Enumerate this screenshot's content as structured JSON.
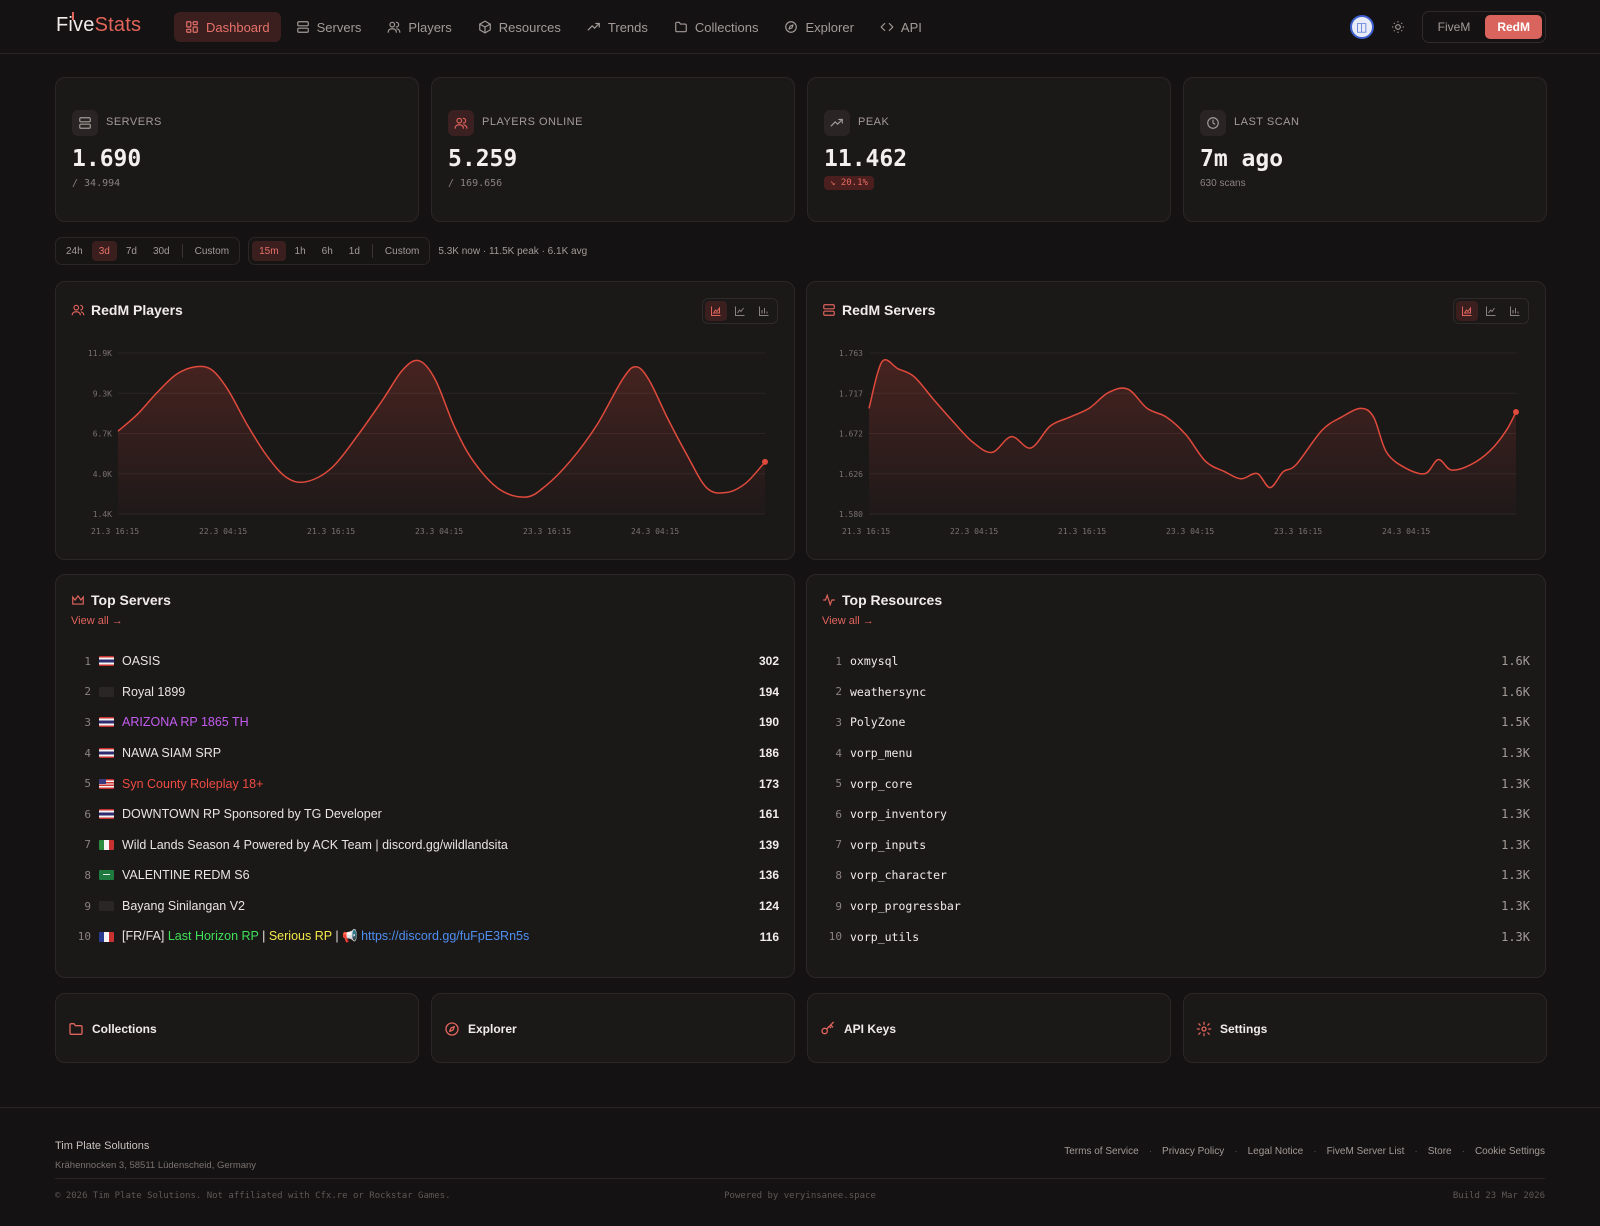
{
  "brand": {
    "first": "Five",
    "second": "Stats"
  },
  "nav": {
    "items": [
      {
        "label": "Dashboard",
        "icon": "dashboard-icon",
        "active": true
      },
      {
        "label": "Servers",
        "icon": "servers-icon"
      },
      {
        "label": "Players",
        "icon": "players-icon"
      },
      {
        "label": "Resources",
        "icon": "resources-icon"
      },
      {
        "label": "Trends",
        "icon": "trends-icon"
      },
      {
        "label": "Collections",
        "icon": "folder-icon"
      },
      {
        "label": "Explorer",
        "icon": "compass-icon"
      },
      {
        "label": "API",
        "icon": "code-icon"
      }
    ],
    "game_options": [
      "FiveM",
      "RedM"
    ],
    "game_selected": "RedM"
  },
  "stats": [
    {
      "label": "SERVERS",
      "value": "1.690",
      "sub": "/ 34.994",
      "icon": "servers-icon"
    },
    {
      "label": "PLAYERS ONLINE",
      "value": "5.259",
      "sub": "/ 169.656",
      "icon": "players-icon"
    },
    {
      "label": "PEAK",
      "value": "11.462",
      "badge": "↘ 20.1%",
      "icon": "trend-up-icon"
    },
    {
      "label": "LAST SCAN",
      "value": "7m ago",
      "sub": "630 scans",
      "icon": "clock-icon"
    }
  ],
  "filters": {
    "ranges": [
      "24h",
      "3d",
      "7d",
      "30d",
      "Custom"
    ],
    "range_selected": "3d",
    "intervals": [
      "15m",
      "1h",
      "6h",
      "1d",
      "Custom"
    ],
    "interval_selected": "15m",
    "summary": "5.3K now · 11.5K peak · 6.1K avg"
  },
  "charts": {
    "players": {
      "title": "RedM Players"
    },
    "servers": {
      "title": "RedM Servers"
    }
  },
  "chart_data": [
    {
      "type": "area",
      "title": "RedM Players",
      "ylim": [
        1400,
        11900
      ],
      "yticks": [
        "11.9K",
        "9.3K",
        "6.7K",
        "4.0K",
        "1.4K"
      ],
      "xticks": [
        "21.3 16:15",
        "22.3 04:15",
        "21.3 16:15",
        "23.3 04:15",
        "23.3 16:15",
        "24.3 04:15"
      ],
      "x_fraction": [
        0,
        0.03,
        0.06,
        0.09,
        0.12,
        0.145,
        0.17,
        0.2,
        0.23,
        0.26,
        0.29,
        0.33,
        0.37,
        0.41,
        0.44,
        0.465,
        0.49,
        0.52,
        0.55,
        0.59,
        0.63,
        0.66,
        0.7,
        0.74,
        0.78,
        0.8,
        0.82,
        0.85,
        0.88,
        0.91,
        0.94,
        0.97,
        1.0
      ],
      "values": [
        6800,
        7900,
        9300,
        10500,
        11000,
        10800,
        9500,
        7200,
        5200,
        3800,
        3500,
        4400,
        6500,
        8900,
        10800,
        11400,
        10200,
        7100,
        4800,
        3000,
        2500,
        3200,
        4900,
        7200,
        10200,
        11000,
        10200,
        7600,
        5200,
        3100,
        2800,
        3400,
        4800
      ]
    },
    {
      "type": "area",
      "title": "RedM Servers",
      "ylim": [
        1580,
        1763
      ],
      "yticks": [
        "1.763",
        "1.717",
        "1.672",
        "1.626",
        "1.580"
      ],
      "xticks": [
        "21.3 16:15",
        "22.3 04:15",
        "21.3 16:15",
        "23.3 04:15",
        "23.3 16:15",
        "24.3 04:15"
      ],
      "x_fraction": [
        0,
        0.02,
        0.045,
        0.07,
        0.1,
        0.13,
        0.16,
        0.19,
        0.22,
        0.25,
        0.28,
        0.31,
        0.34,
        0.37,
        0.4,
        0.43,
        0.46,
        0.49,
        0.52,
        0.55,
        0.575,
        0.6,
        0.62,
        0.64,
        0.66,
        0.7,
        0.73,
        0.76,
        0.78,
        0.8,
        0.83,
        0.86,
        0.88,
        0.9,
        0.93,
        0.96,
        0.985,
        1.0
      ],
      "values": [
        1700,
        1753,
        1745,
        1736,
        1710,
        1685,
        1662,
        1650,
        1668,
        1655,
        1680,
        1690,
        1700,
        1718,
        1722,
        1700,
        1690,
        1670,
        1640,
        1628,
        1620,
        1626,
        1610,
        1628,
        1636,
        1675,
        1690,
        1700,
        1690,
        1650,
        1632,
        1626,
        1642,
        1630,
        1636,
        1652,
        1675,
        1696
      ]
    }
  ],
  "top_servers": {
    "title": "Top Servers",
    "view_all": "View all →",
    "rows": [
      {
        "rank": "1",
        "flag": "th",
        "name": "OASIS",
        "count": "302"
      },
      {
        "rank": "2",
        "flag": "none",
        "name": "Royal 1899",
        "count": "194"
      },
      {
        "rank": "3",
        "flag": "th",
        "name": "ARIZONA RP 1865 TH",
        "count": "190",
        "color": "#c45cf0"
      },
      {
        "rank": "4",
        "flag": "th",
        "name": "NAWA SIAM SRP",
        "count": "186"
      },
      {
        "rank": "5",
        "flag": "us",
        "name": "Syn County Roleplay 18+",
        "count": "173",
        "color": "#ef4b43"
      },
      {
        "rank": "6",
        "flag": "th",
        "name": "DOWNTOWN RP Sponsored by TG Developer",
        "count": "161"
      },
      {
        "rank": "7",
        "flag": "it",
        "name": "Wild Lands Season 4 Powered by ACK Team | discord.gg/wildlandsita",
        "count": "139"
      },
      {
        "rank": "8",
        "flag": "sa",
        "name": "VALENTINE REDM S6",
        "count": "136"
      },
      {
        "rank": "9",
        "flag": "none",
        "name": "Bayang Sinilangan V2",
        "count": "124"
      },
      {
        "rank": "10",
        "flag": "fr",
        "segments": [
          {
            "text": "[FR/FA] ",
            "color": "#e8e4e2"
          },
          {
            "text": "Last Horizon RP",
            "color": "#3fe05a"
          },
          {
            "text": " | ",
            "color": "#e8e4e2"
          },
          {
            "text": "Serious RP",
            "color": "#f5e94a"
          },
          {
            "text": " |  📢  ",
            "color": "#e8e4e2"
          },
          {
            "text": "https://discord.gg/fuFpE3Rn5s",
            "color": "#4f8ff0"
          }
        ],
        "count": "116"
      }
    ]
  },
  "top_resources": {
    "title": "Top Resources",
    "view_all": "View all →",
    "rows": [
      {
        "rank": "1",
        "name": "oxmysql",
        "count": "1.6K"
      },
      {
        "rank": "2",
        "name": "weathersync",
        "count": "1.6K"
      },
      {
        "rank": "3",
        "name": "PolyZone",
        "count": "1.5K"
      },
      {
        "rank": "4",
        "name": "vorp_menu",
        "count": "1.3K"
      },
      {
        "rank": "5",
        "name": "vorp_core",
        "count": "1.3K"
      },
      {
        "rank": "6",
        "name": "vorp_inventory",
        "count": "1.3K"
      },
      {
        "rank": "7",
        "name": "vorp_inputs",
        "count": "1.3K"
      },
      {
        "rank": "8",
        "name": "vorp_character",
        "count": "1.3K"
      },
      {
        "rank": "9",
        "name": "vorp_progressbar",
        "count": "1.3K"
      },
      {
        "rank": "10",
        "name": "vorp_utils",
        "count": "1.3K"
      }
    ]
  },
  "quick_links": [
    {
      "label": "Collections",
      "icon": "folder-icon"
    },
    {
      "label": "Explorer",
      "icon": "compass-icon"
    },
    {
      "label": "API Keys",
      "icon": "key-icon"
    },
    {
      "label": "Settings",
      "icon": "gear-icon"
    }
  ],
  "footer": {
    "company": "Tim Plate Solutions",
    "address": "Krähennocken 3, 58511 Lüdenscheid, Germany",
    "links": [
      "Terms of Service",
      "Privacy Policy",
      "Legal Notice",
      "FiveM Server List",
      "Store",
      "Cookie Settings"
    ],
    "copyright": "© 2026 Tim Plate Solutions. Not affiliated with Cfx.re or Rockstar Games.",
    "powered": "Powered by veryinsanee.space",
    "build": "Build 23 Mar 2026"
  },
  "colors": {
    "accent": "#e0645c",
    "line": "#e04a3c"
  }
}
